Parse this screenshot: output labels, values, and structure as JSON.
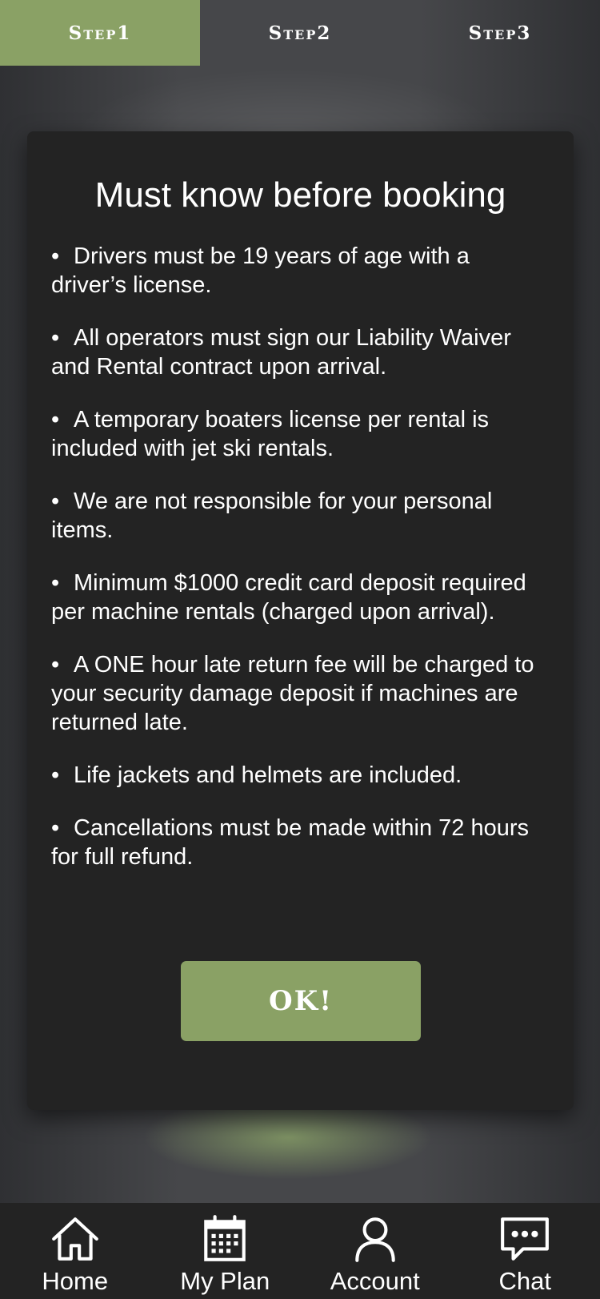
{
  "steps": [
    {
      "label": "Step1",
      "active": true
    },
    {
      "label": "Step2",
      "active": false
    },
    {
      "label": "Step3",
      "active": false
    }
  ],
  "modal": {
    "title": "Must know before booking",
    "bullet": "•",
    "rules": [
      "Drivers must be 19 years of age with a driver’s license.",
      "All operators must sign our Liability Waiver and Rental contract upon arrival.",
      "A temporary boaters license per rental is included with jet ski rentals.",
      "We are not responsible for your personal items.",
      "Minimum $1000 credit card deposit required per machine rentals (charged upon arrival).",
      "A ONE hour late return fee will be charged to your security damage deposit if machines are returned late.",
      "Life jackets and helmets are included.",
      "Cancellations must be made within 72 hours for full refund."
    ],
    "ok_label": "OK!"
  },
  "bottom_nav": {
    "items": [
      {
        "label": "Home",
        "icon": "home-icon"
      },
      {
        "label": "My Plan",
        "icon": "calendar-icon"
      },
      {
        "label": "Account",
        "icon": "user-icon"
      },
      {
        "label": "Chat",
        "icon": "chat-icon"
      }
    ]
  },
  "colors": {
    "accent": "#8aa165",
    "modal_bg": "#232323",
    "page_bg": "#3d3e41"
  }
}
